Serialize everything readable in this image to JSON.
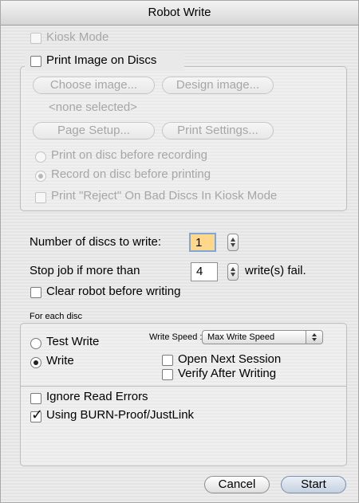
{
  "window": {
    "title": "Robot Write"
  },
  "kiosk_mode": {
    "label": "Kiosk Mode",
    "checked": false,
    "enabled": false
  },
  "print_image": {
    "label": "Print Image on Discs",
    "checked": false,
    "choose_image_label": "Choose image...",
    "design_image_label": "Design image...",
    "selected_image_text": "<none selected>",
    "page_setup_label": "Page Setup...",
    "print_settings_label": "Print Settings...",
    "radio_print_before_label": "Print on disc before recording",
    "radio_record_before_label": "Record on disc before printing",
    "reject_label": "Print \"Reject\" On Bad Discs In Kiosk Mode"
  },
  "discs": {
    "number_label": "Number of discs to write:",
    "number_value": "1",
    "stop_label": "Stop job if more than",
    "stop_value": "4",
    "stop_suffix": "write(s) fail.",
    "clear_robot_label": "Clear robot before writing"
  },
  "for_each_disc": {
    "section_label": "For each disc",
    "test_write_label": "Test Write",
    "write_label": "Write",
    "write_speed_label": "Write Speed :",
    "write_speed_value": "Max Write Speed",
    "open_next_session_label": "Open Next Session",
    "verify_after_writing_label": "Verify After Writing",
    "ignore_read_errors_label": "Ignore Read Errors",
    "burn_proof_label": "Using BURN-Proof/JustLink",
    "selected_mode": "Write"
  },
  "buttons": {
    "cancel": "Cancel",
    "start": "Start"
  }
}
